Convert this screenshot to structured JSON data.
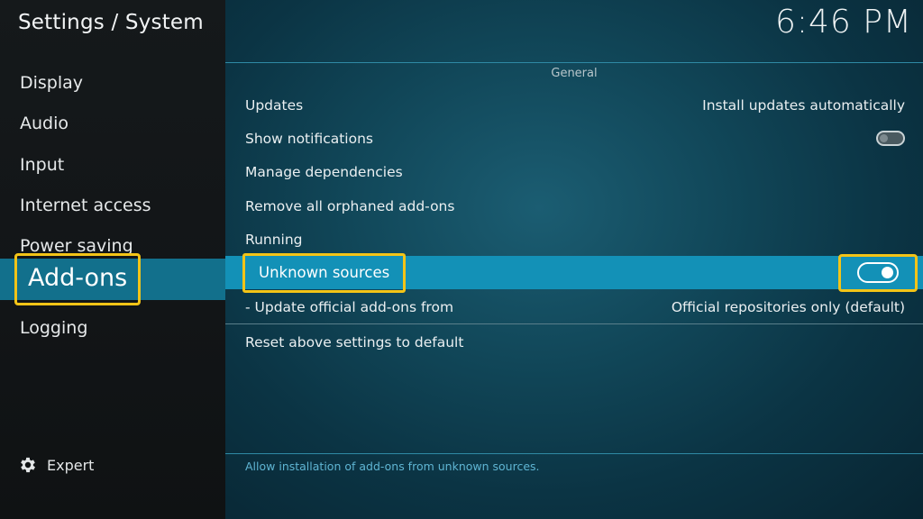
{
  "header": {
    "title": "Settings / System",
    "clock": "6:46 PM"
  },
  "sidebar": {
    "items": [
      {
        "label": "Display"
      },
      {
        "label": "Audio"
      },
      {
        "label": "Input"
      },
      {
        "label": "Internet access"
      },
      {
        "label": "Power saving"
      },
      {
        "label": "Add-ons",
        "active": true
      },
      {
        "label": "Logging"
      }
    ],
    "expert_label": "Expert",
    "expert_icon": "gear-icon"
  },
  "main": {
    "section_title": "General",
    "settings": [
      {
        "label": "Updates",
        "value": "Install updates automatically"
      },
      {
        "label": "Show notifications",
        "toggle": false
      },
      {
        "label": "Manage dependencies"
      },
      {
        "label": "Remove all orphaned add-ons"
      },
      {
        "label": "Running"
      },
      {
        "label": "Unknown sources",
        "toggle": true,
        "selected": true
      },
      {
        "label": "- Update official add-ons from",
        "value": "Official repositories only (default)"
      },
      {
        "label": "Reset above settings to default"
      }
    ],
    "help_text": "Allow installation of add-ons from unknown sources."
  },
  "colors": {
    "accent": "#1391b7",
    "highlight_border": "#f3c417",
    "help_text": "#5fb5d3"
  }
}
